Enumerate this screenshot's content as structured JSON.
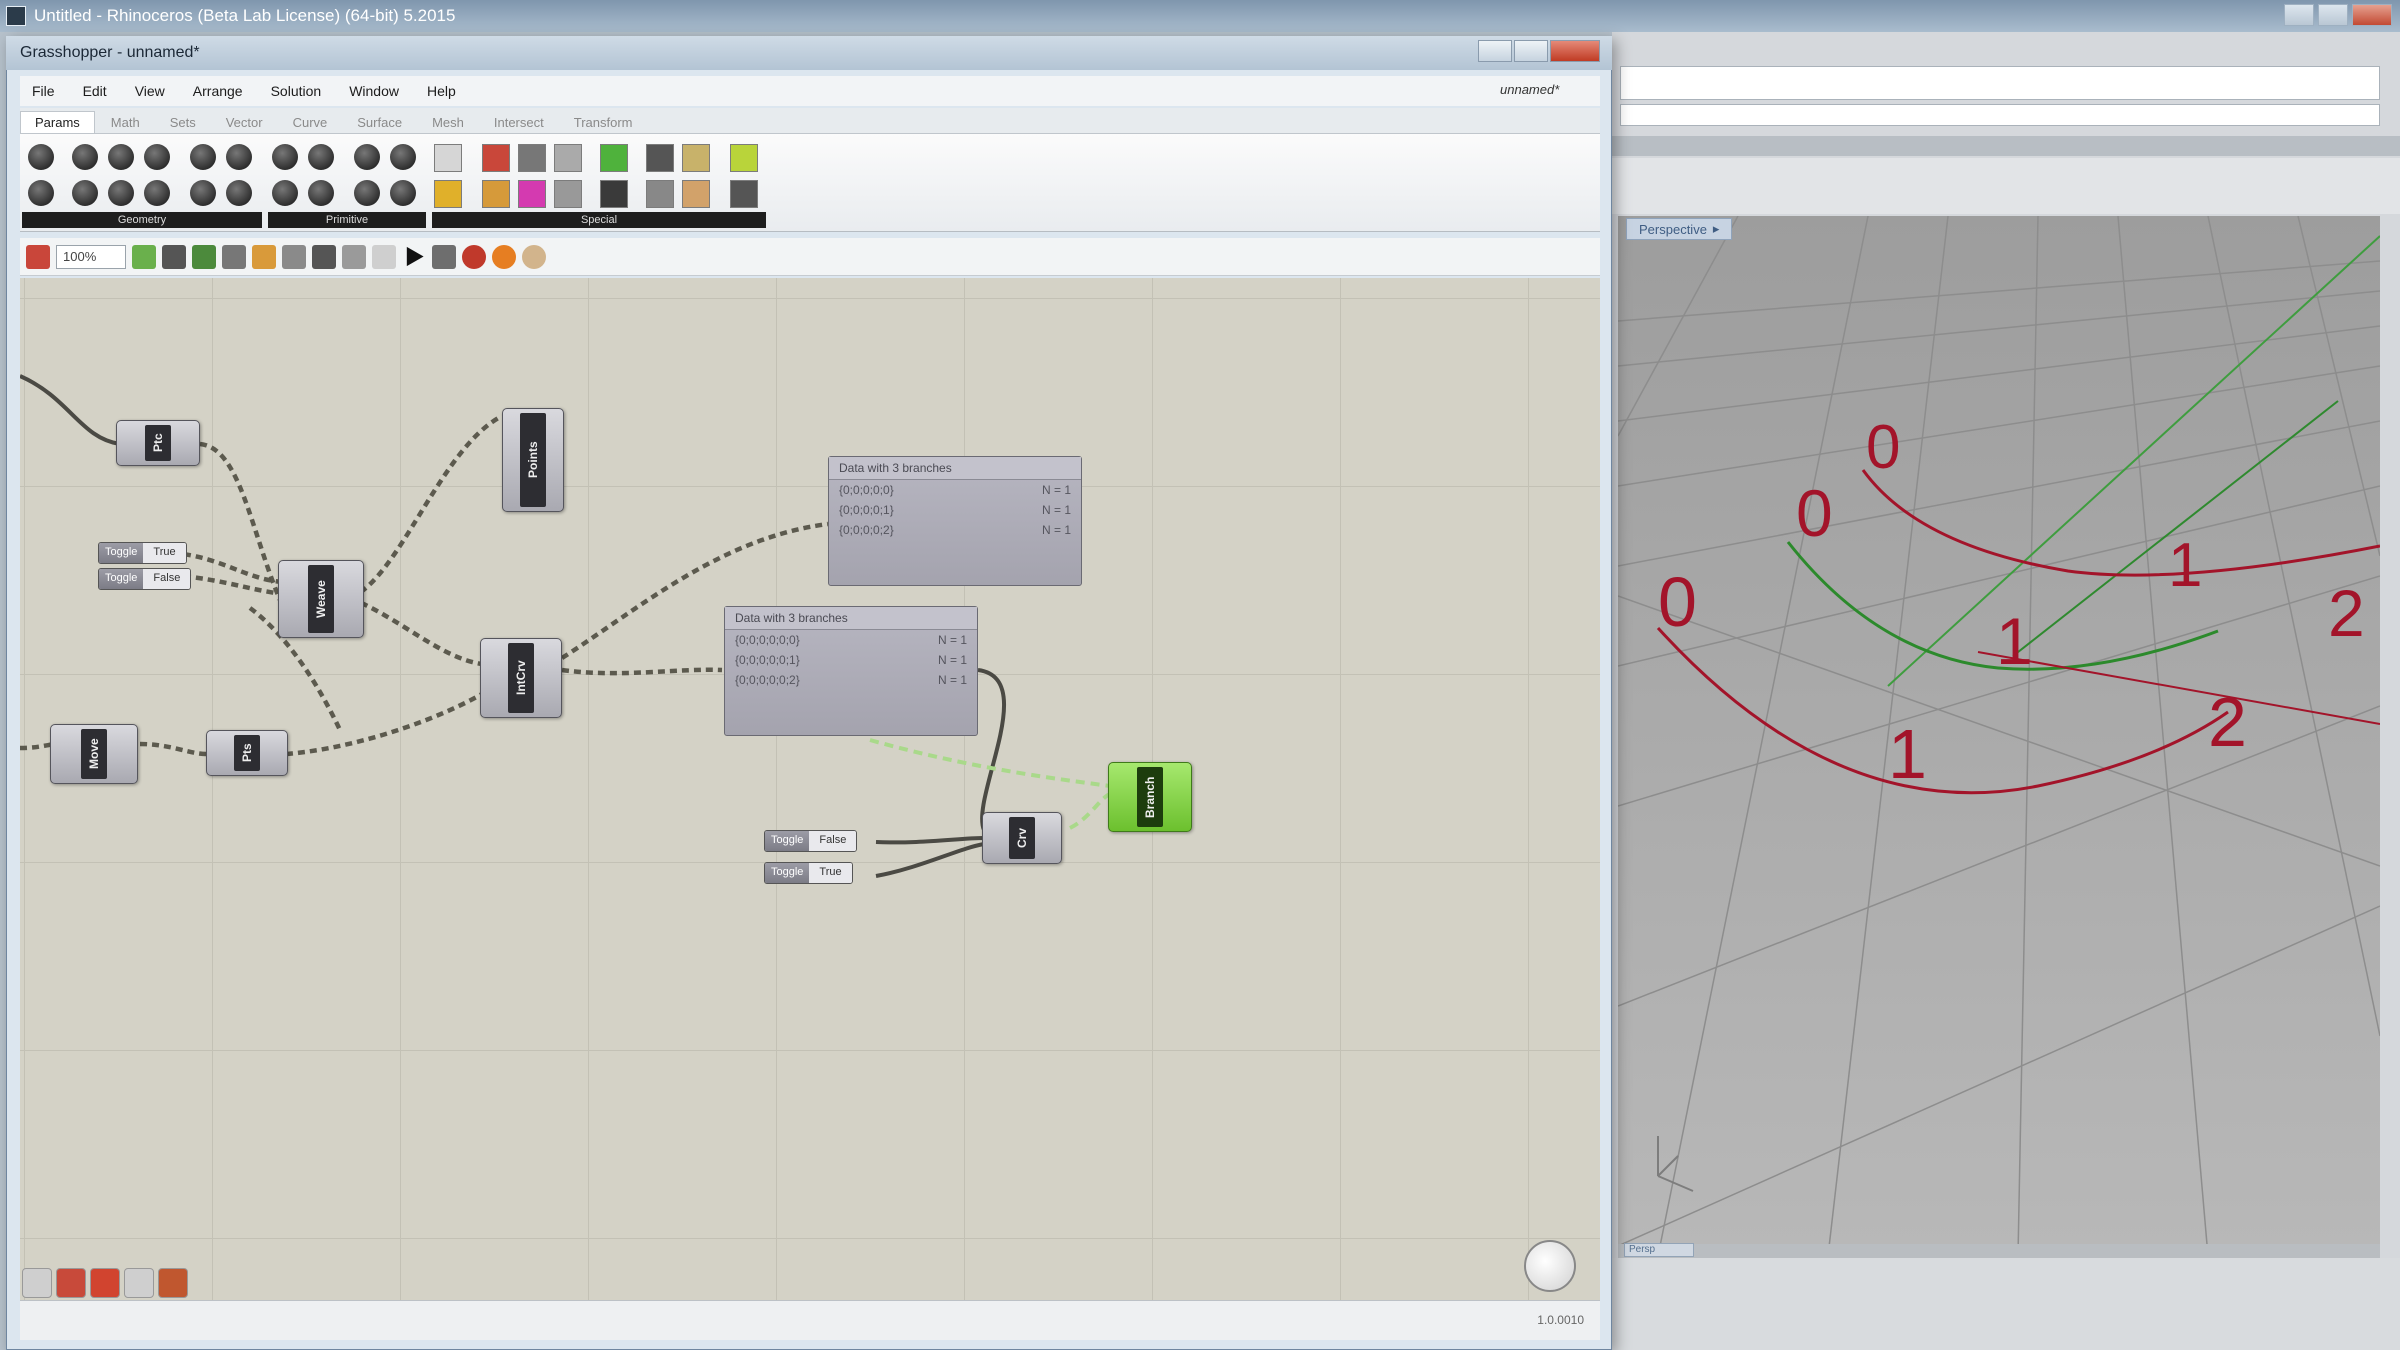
{
  "rhino": {
    "title": "Untitled - Rhinoceros (Beta Lab License) (64-bit) 5.2015",
    "viewport_label": "Perspective",
    "viewport_bottom_tab": "Persp",
    "labels_curve_top": [
      "0",
      "1",
      "2"
    ],
    "labels_curve_green": [
      "0",
      "1",
      "2"
    ],
    "labels_curve_bottom": [
      "0",
      "1",
      "2"
    ],
    "curve_colors": {
      "red": "#a3142a",
      "green": "#2c8a2c",
      "grid": "#909090",
      "green_axis": "#3f9d3f"
    }
  },
  "grasshopper": {
    "title": "Grasshopper - unnamed*",
    "document_name": "unnamed*",
    "menu": [
      "File",
      "Edit",
      "View",
      "Arrange",
      "Solution",
      "Window",
      "Help"
    ],
    "tabs": [
      "Params",
      "Math",
      "Sets",
      "Vector",
      "Curve",
      "Surface",
      "Mesh",
      "Intersect",
      "Transform"
    ],
    "active_tab": "Params",
    "ribbon_groups": [
      "Geometry",
      "Primitive",
      "Special"
    ],
    "zoom": "100%",
    "status_text": "1.0.0010",
    "components": {
      "a": "Ptc",
      "points": "Points",
      "weave": "Weave",
      "move": "Move",
      "prx": "Pts",
      "ipcrv": "IntCrv",
      "crv": "Crv",
      "branch": "Branch"
    },
    "toggles": [
      {
        "label": "Toggle",
        "value": "True"
      },
      {
        "label": "Toggle",
        "value": "False"
      },
      {
        "label": "Toggle",
        "value": "False"
      },
      {
        "label": "Toggle",
        "value": "True"
      }
    ],
    "panel1": {
      "title": "Data with 3 branches",
      "rows": [
        [
          "{0;0;0;0;0}",
          "N = 1"
        ],
        [
          "{0;0;0;0;1}",
          "N = 1"
        ],
        [
          "{0;0;0;0;2}",
          "N = 1"
        ]
      ]
    },
    "panel2": {
      "title": "Data with 3 branches",
      "rows": [
        [
          "{0;0;0;0;0;0}",
          "N = 1"
        ],
        [
          "{0;0;0;0;0;1}",
          "N = 1"
        ],
        [
          "{0;0;0;0;0;2}",
          "N = 1"
        ]
      ]
    },
    "colors": {
      "canvas": "#d4d2c6",
      "component": "#a9a9b1",
      "selected": "#7fd13a"
    }
  }
}
